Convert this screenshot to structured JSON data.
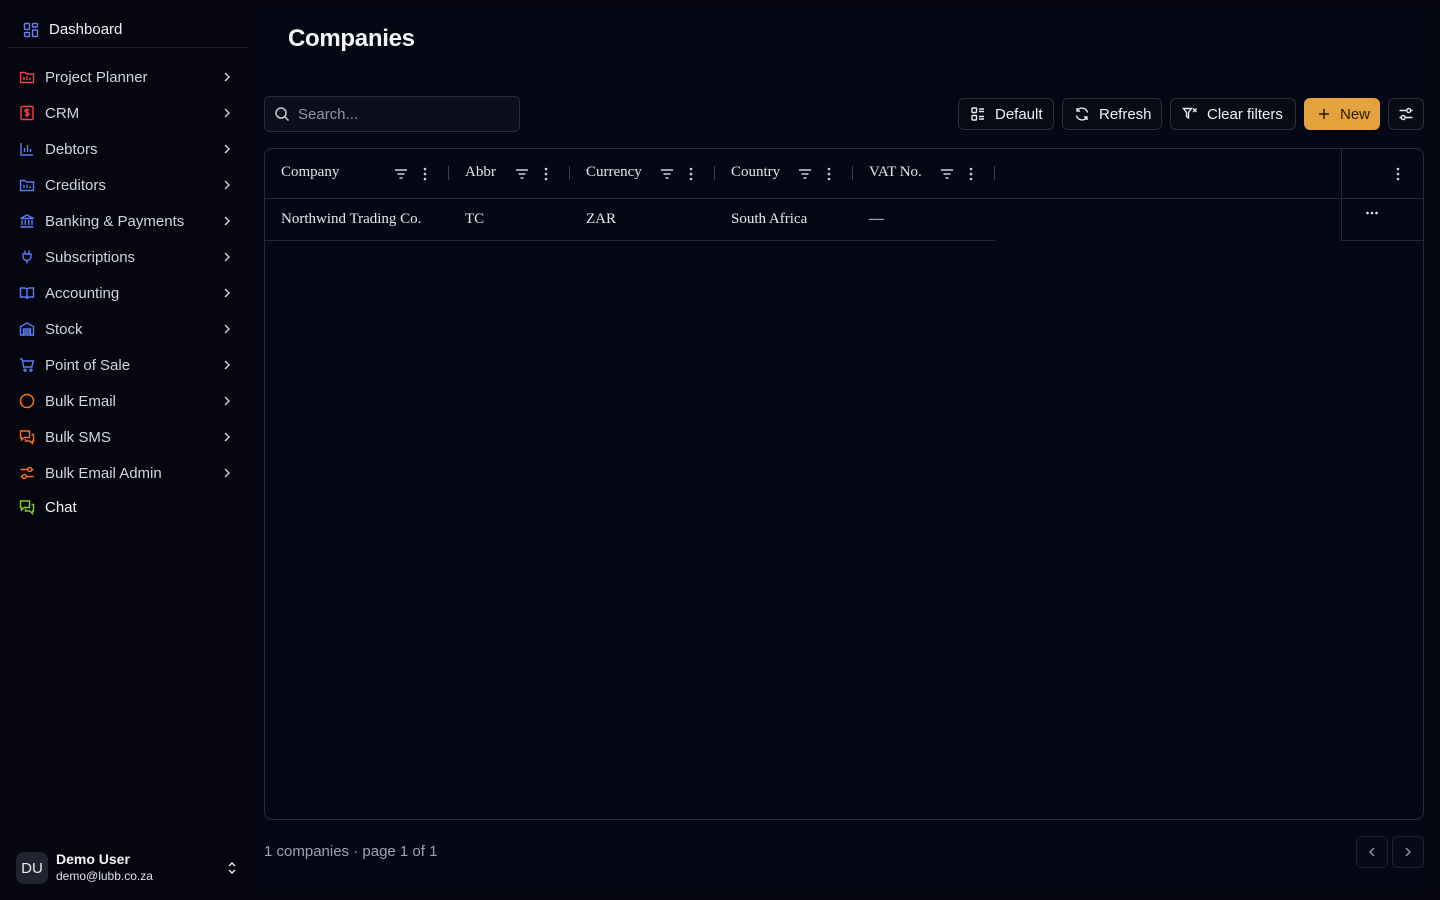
{
  "sidebar": {
    "dashboard": {
      "label": "Dashboard",
      "icon": "layout-grid-icon",
      "color": "#6d7cf5"
    },
    "items": [
      {
        "label": "Project Planner",
        "icon": "folder-chart-icon",
        "color": "#ef4444"
      },
      {
        "label": "CRM",
        "icon": "dollar-box-icon",
        "color": "#ef4444"
      },
      {
        "label": "Debtors",
        "icon": "bar-chart-icon",
        "color": "#5b7cf5"
      },
      {
        "label": "Creditors",
        "icon": "folder-chart-icon",
        "color": "#5b7cf5"
      },
      {
        "label": "Banking & Payments",
        "icon": "bank-icon",
        "color": "#5b7cf5"
      },
      {
        "label": "Subscriptions",
        "icon": "plug-icon",
        "color": "#5b7cf5"
      },
      {
        "label": "Accounting",
        "icon": "book-open-icon",
        "color": "#5b7cf5"
      },
      {
        "label": "Stock",
        "icon": "warehouse-icon",
        "color": "#5b7cf5"
      },
      {
        "label": "Point of Sale",
        "icon": "cart-icon",
        "color": "#5b7cf5"
      },
      {
        "label": "Bulk Email",
        "icon": "circle-icon",
        "color": "#f97316"
      },
      {
        "label": "Bulk SMS",
        "icon": "messages-icon",
        "color": "#f97316"
      },
      {
        "label": "Bulk Email Admin",
        "icon": "sliders-icon",
        "color": "#f97316"
      }
    ],
    "chat": {
      "label": "Chat",
      "icon": "messages-icon",
      "color": "#84cc16"
    }
  },
  "user": {
    "initials": "DU",
    "name": "Demo User",
    "email": "demo@lubb.co.za"
  },
  "page": {
    "title": "Companies"
  },
  "toolbar": {
    "search_placeholder": "Search...",
    "default_label": "Default",
    "refresh_label": "Refresh",
    "clear_filters_label": "Clear filters",
    "new_label": "New",
    "accent_color": "#e3a23b"
  },
  "table": {
    "columns": [
      "Company",
      "Abbr",
      "Currency",
      "Country",
      "VAT No."
    ],
    "rows": [
      {
        "company": "Northwind Trading Co.",
        "abbr": "TC",
        "currency": "ZAR",
        "country": "South Africa",
        "vat": "—"
      }
    ]
  },
  "footer": {
    "summary": "1 companies · page 1 of 1"
  }
}
